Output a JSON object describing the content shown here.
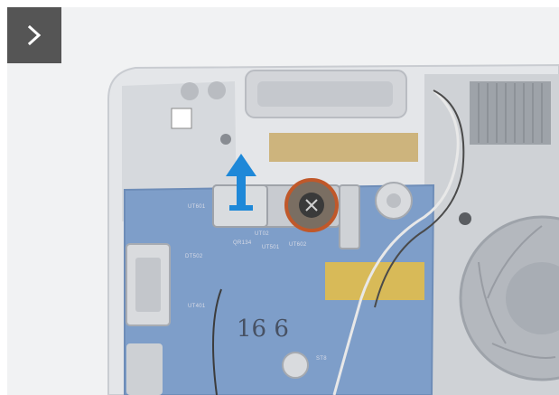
{
  "navigation": {
    "next_button_label": "Next",
    "next_icon": "chevron-right-icon"
  },
  "illustration": {
    "action_arrow_icon": "arrow-up-icon",
    "highlight_color": "#c0582a",
    "arrow_color": "#1e88d8",
    "board_labels": [
      "UT02",
      "UT501",
      "QR134",
      "UT602",
      "DT502",
      "UT601",
      "UT401",
      "ST8"
    ],
    "handwriting": "16 6"
  }
}
